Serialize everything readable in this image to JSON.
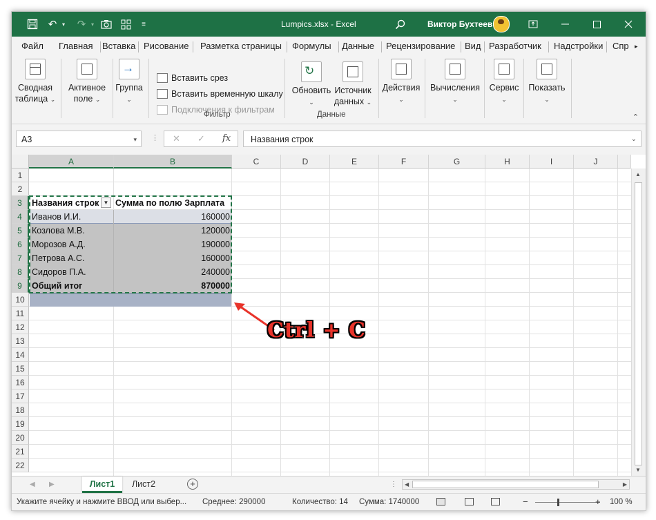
{
  "titlebar": {
    "filename": "Lumpics.xlsx",
    "separator": " - ",
    "app": "Excel",
    "user": "Виктор Бухтеев",
    "accent": "#1e7145"
  },
  "menu": {
    "tabs": [
      "Файл",
      "Главная",
      "Вставка",
      "Рисование",
      "Разметка страницы",
      "Формулы",
      "Данные",
      "Рецензирование",
      "Вид",
      "Разработчик",
      "Надстройки",
      "Спр"
    ]
  },
  "ribbon": {
    "pivot_table": [
      "Сводная",
      "таблица"
    ],
    "active_field": [
      "Активное",
      "поле"
    ],
    "group": "Группа",
    "insert_slicer": "Вставить срез",
    "insert_timeline": "Вставить временную шкалу",
    "filter_connections": "Подключения к фильтрам",
    "filter_group": "Фильтр",
    "refresh": "Обновить",
    "source": [
      "Источник",
      "данных"
    ],
    "data_group": "Данные",
    "actions": "Действия",
    "calculations": "Вычисления",
    "tools": "Сервис",
    "show": "Показать"
  },
  "formula_bar": {
    "name_box": "A3",
    "formula": "Названия строк"
  },
  "grid": {
    "columns": [
      "A",
      "B",
      "C",
      "D",
      "E",
      "F",
      "G",
      "H",
      "I",
      "J"
    ],
    "rows": [
      "1",
      "2",
      "3",
      "4",
      "5",
      "6",
      "7",
      "8",
      "9",
      "10",
      "11",
      "12",
      "13",
      "14",
      "15",
      "16",
      "17",
      "18",
      "19",
      "20",
      "21",
      "22"
    ]
  },
  "pivot": {
    "header": [
      "Названия строк",
      "Сумма по полю Зарплата"
    ],
    "rows": [
      {
        "name": "Иванов И.И.",
        "value": "160000"
      },
      {
        "name": "Козлова М.В.",
        "value": "120000"
      },
      {
        "name": "Морозов А.Д.",
        "value": "190000"
      },
      {
        "name": "Петрова А.С.",
        "value": "160000"
      },
      {
        "name": "Сидоров П.А.",
        "value": "240000"
      }
    ],
    "total": {
      "name": "Общий итог",
      "value": "870000"
    }
  },
  "annotation": {
    "text": "Ctrl + C",
    "color": "#e8332a"
  },
  "sheets": {
    "tabs": [
      "Лист1",
      "Лист2"
    ],
    "active": "Лист1"
  },
  "status": {
    "message": "Укажите ячейку и нажмите ВВОД или выбер...",
    "average": "Среднее: 290000",
    "count": "Количество: 14",
    "sum": "Сумма: 1740000",
    "zoom": "100 %"
  }
}
